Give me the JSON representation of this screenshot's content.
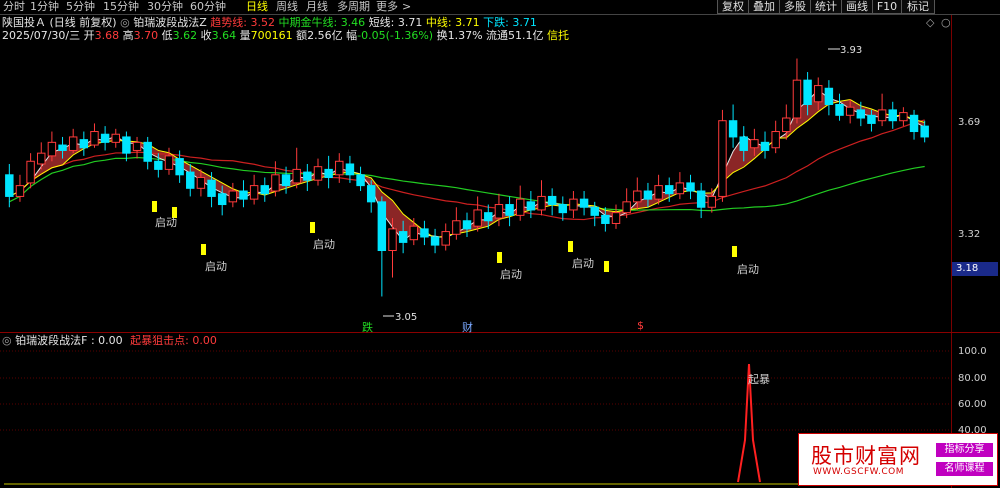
{
  "toolbar": {
    "periods": [
      "分时",
      "1分钟",
      "5分钟",
      "15分钟",
      "30分钟",
      "60分钟",
      "日线",
      "周线",
      "月线",
      "多周期",
      "更多"
    ],
    "active_period": "日线",
    "more_arrow": ">",
    "buttons": [
      "复权",
      "叠加",
      "多股",
      "统计",
      "画线",
      "F10",
      "标记"
    ]
  },
  "header": {
    "stock": "陕国投Ａ",
    "mode": "(日线 前复权)",
    "indicator_name": "铂瑞波段战法Z",
    "lines": [
      {
        "label": "趋势线:",
        "value": "3.52",
        "color": "#ff3b3b"
      },
      {
        "label": "中期金牛线:",
        "value": "3.46",
        "color": "#22dd22"
      },
      {
        "label": "短线:",
        "value": "3.71",
        "color": "#e6e6e6"
      },
      {
        "label": "中线:",
        "value": "3.71",
        "color": "#ffff00"
      },
      {
        "label": "下跌:",
        "value": "3.71",
        "color": "#00e5ff"
      }
    ]
  },
  "quote": {
    "date": "2025/07/30/三",
    "open_label": "开",
    "open": "3.68",
    "high_label": "高",
    "high": "3.70",
    "low_label": "低",
    "low": "3.62",
    "close_label": "收",
    "close": "3.64",
    "volume_label": "量",
    "volume": "700161",
    "amount_label": "额",
    "amount": "2.56亿",
    "change_label": "幅",
    "change": "-0.05(-1.36%)",
    "turnover_label": "换",
    "turnover": "1.37%",
    "float_label": "流通",
    "float": "51.1亿",
    "sector": "信托"
  },
  "price_axis": {
    "ticks": [
      "3.69",
      "3.32"
    ],
    "current": "3.18"
  },
  "annotations": {
    "high_mark": "3.93",
    "low_mark": "3.05",
    "signal_label": "启动",
    "bottom_marks": [
      {
        "text": "跌",
        "color": "#22dd22"
      },
      {
        "text": "财",
        "color": "#7aa8ff"
      },
      {
        "text": "$",
        "color": "#ff3b3b"
      }
    ]
  },
  "sub_indicator": {
    "name": "铂瑞波段战法F",
    "value_label": ": 0.00",
    "signal_label": "起暴狙击点:",
    "signal_value": "0.00",
    "peak_label": "起暴",
    "ticks": [
      "100.0",
      "80.00",
      "60.00",
      "40.00"
    ]
  },
  "watermark": {
    "title": "股市财富网",
    "url": "WWW.GSCFW.COM",
    "badge1": "指标分享",
    "badge2": "名师课程"
  },
  "colors": {
    "background": "#000000",
    "up": "#ff3b3b",
    "down": "#00e5ff",
    "trend": "#cc2020",
    "mid_bull": "#22cc22",
    "band": "#9a2a2a",
    "signal": "#ffff00"
  },
  "chart_data": {
    "type": "candlestick",
    "title": "陕国投Ａ (日线 前复权)",
    "y_ticks": [
      3.69,
      3.32
    ],
    "ylim": [
      3.0,
      4.0
    ],
    "marked_high": 3.93,
    "marked_low": 3.05,
    "last_bar": {
      "date": "2025/07/30",
      "open": 3.68,
      "high": 3.7,
      "low": 3.62,
      "close": 3.64
    },
    "series": [
      {
        "name": "趋势线",
        "last": 3.52
      },
      {
        "name": "中期金牛线",
        "last": 3.46
      },
      {
        "name": "短线",
        "last": 3.71
      },
      {
        "name": "中线",
        "last": 3.71
      },
      {
        "name": "下跌",
        "last": 3.71
      }
    ],
    "candles": [
      [
        3.5,
        3.42,
        3.54,
        3.38
      ],
      [
        3.42,
        3.46,
        3.5,
        3.4
      ],
      [
        3.47,
        3.55,
        3.58,
        3.45
      ],
      [
        3.54,
        3.58,
        3.62,
        3.52
      ],
      [
        3.57,
        3.62,
        3.66,
        3.55
      ],
      [
        3.61,
        3.59,
        3.64,
        3.56
      ],
      [
        3.59,
        3.64,
        3.67,
        3.58
      ],
      [
        3.63,
        3.6,
        3.66,
        3.57
      ],
      [
        3.61,
        3.66,
        3.69,
        3.6
      ],
      [
        3.65,
        3.62,
        3.68,
        3.59
      ],
      [
        3.62,
        3.65,
        3.67,
        3.6
      ],
      [
        3.64,
        3.58,
        3.66,
        3.55
      ],
      [
        3.59,
        3.62,
        3.64,
        3.56
      ],
      [
        3.62,
        3.55,
        3.64,
        3.52
      ],
      [
        3.55,
        3.52,
        3.58,
        3.49
      ],
      [
        3.52,
        3.57,
        3.6,
        3.5
      ],
      [
        3.56,
        3.5,
        3.59,
        3.47
      ],
      [
        3.51,
        3.45,
        3.54,
        3.42
      ],
      [
        3.45,
        3.49,
        3.52,
        3.42
      ],
      [
        3.48,
        3.42,
        3.51,
        3.38
      ],
      [
        3.43,
        3.39,
        3.46,
        3.35
      ],
      [
        3.4,
        3.44,
        3.47,
        3.38
      ],
      [
        3.44,
        3.41,
        3.48,
        3.38
      ],
      [
        3.41,
        3.46,
        3.5,
        3.39
      ],
      [
        3.46,
        3.43,
        3.49,
        3.4
      ],
      [
        3.44,
        3.5,
        3.55,
        3.42
      ],
      [
        3.5,
        3.46,
        3.53,
        3.43
      ],
      [
        3.47,
        3.52,
        3.6,
        3.45
      ],
      [
        3.51,
        3.48,
        3.54,
        3.44
      ],
      [
        3.48,
        3.53,
        3.56,
        3.46
      ],
      [
        3.52,
        3.49,
        3.57,
        3.45
      ],
      [
        3.5,
        3.55,
        3.58,
        3.47
      ],
      [
        3.54,
        3.5,
        3.57,
        3.47
      ],
      [
        3.5,
        3.46,
        3.53,
        3.44
      ],
      [
        3.46,
        3.4,
        3.48,
        3.36
      ],
      [
        3.4,
        3.22,
        3.42,
        3.05
      ],
      [
        3.22,
        3.3,
        3.34,
        3.12
      ],
      [
        3.29,
        3.25,
        3.33,
        3.21
      ],
      [
        3.26,
        3.31,
        3.34,
        3.24
      ],
      [
        3.3,
        3.27,
        3.33,
        3.24
      ],
      [
        3.27,
        3.24,
        3.3,
        3.21
      ],
      [
        3.24,
        3.29,
        3.32,
        3.22
      ],
      [
        3.28,
        3.33,
        3.38,
        3.26
      ],
      [
        3.33,
        3.3,
        3.36,
        3.27
      ],
      [
        3.31,
        3.37,
        3.42,
        3.29
      ],
      [
        3.36,
        3.33,
        3.39,
        3.3
      ],
      [
        3.34,
        3.39,
        3.43,
        3.31
      ],
      [
        3.39,
        3.35,
        3.42,
        3.31
      ],
      [
        3.35,
        3.41,
        3.46,
        3.33
      ],
      [
        3.4,
        3.37,
        3.44,
        3.34
      ],
      [
        3.37,
        3.42,
        3.48,
        3.35
      ],
      [
        3.42,
        3.39,
        3.45,
        3.35
      ],
      [
        3.39,
        3.36,
        3.42,
        3.33
      ],
      [
        3.37,
        3.41,
        3.44,
        3.34
      ],
      [
        3.41,
        3.38,
        3.44,
        3.35
      ],
      [
        3.38,
        3.35,
        3.4,
        3.31
      ],
      [
        3.35,
        3.32,
        3.38,
        3.29
      ],
      [
        3.32,
        3.36,
        3.39,
        3.3
      ],
      [
        3.36,
        3.4,
        3.45,
        3.34
      ],
      [
        3.4,
        3.44,
        3.49,
        3.37
      ],
      [
        3.44,
        3.41,
        3.47,
        3.38
      ],
      [
        3.41,
        3.46,
        3.5,
        3.39
      ],
      [
        3.46,
        3.43,
        3.49,
        3.4
      ],
      [
        3.43,
        3.47,
        3.51,
        3.41
      ],
      [
        3.47,
        3.44,
        3.5,
        3.41
      ],
      [
        3.44,
        3.38,
        3.47,
        3.34
      ],
      [
        3.38,
        3.42,
        3.45,
        3.36
      ],
      [
        3.42,
        3.7,
        3.74,
        3.4
      ],
      [
        3.7,
        3.64,
        3.76,
        3.6
      ],
      [
        3.64,
        3.59,
        3.68,
        3.55
      ],
      [
        3.6,
        3.63,
        3.67,
        3.57
      ],
      [
        3.62,
        3.59,
        3.66,
        3.56
      ],
      [
        3.6,
        3.66,
        3.7,
        3.58
      ],
      [
        3.66,
        3.71,
        3.76,
        3.63
      ],
      [
        3.71,
        3.85,
        3.93,
        3.69
      ],
      [
        3.85,
        3.76,
        3.88,
        3.72
      ],
      [
        3.77,
        3.83,
        3.86,
        3.74
      ],
      [
        3.82,
        3.76,
        3.85,
        3.72
      ],
      [
        3.76,
        3.72,
        3.8,
        3.7
      ],
      [
        3.72,
        3.75,
        3.78,
        3.69
      ],
      [
        3.74,
        3.71,
        3.77,
        3.68
      ],
      [
        3.72,
        3.69,
        3.74,
        3.66
      ],
      [
        3.7,
        3.74,
        3.8,
        3.68
      ],
      [
        3.74,
        3.7,
        3.77,
        3.67
      ],
      [
        3.7,
        3.73,
        3.75,
        3.68
      ],
      [
        3.72,
        3.66,
        3.74,
        3.63
      ],
      [
        3.68,
        3.64,
        3.7,
        3.62
      ]
    ]
  }
}
